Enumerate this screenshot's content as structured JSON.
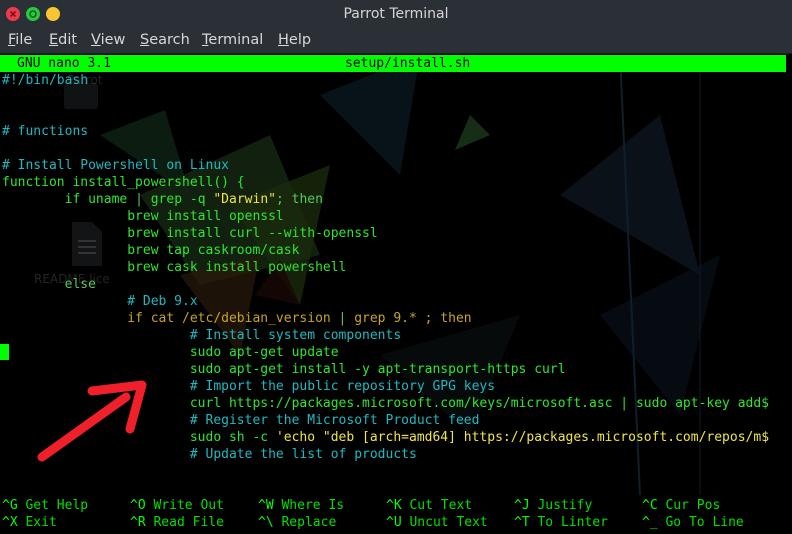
{
  "window": {
    "title": "Parrot Terminal"
  },
  "menu": [
    "File",
    "Edit",
    "View",
    "Search",
    "Terminal",
    "Help"
  ],
  "nano": {
    "version": "GNU nano 3.1",
    "filename": "setup/install.sh"
  },
  "desktop_ghost": {
    "parrot": "Parrot",
    "readme": "README.lice"
  },
  "lines": [
    [
      {
        "t": "#!/bin/bash",
        "c": "c-c"
      }
    ],
    [],
    [],
    [
      {
        "t": "# functions",
        "c": "c-c"
      }
    ],
    [],
    [
      {
        "t": "# Install Powershell on Linux",
        "c": "c-c"
      }
    ],
    [
      {
        "t": "function install_powershell() {",
        "c": "c-bg"
      }
    ],
    [
      {
        "t": "        ",
        "c": "c-g"
      },
      {
        "t": "if",
        "c": "c-bg"
      },
      {
        "t": " uname ",
        "c": "c-bg"
      },
      {
        "t": "|",
        "c": "c-k"
      },
      {
        "t": " grep -q ",
        "c": "c-bg"
      },
      {
        "t": "\"Darwin\"",
        "c": "c-y"
      },
      {
        "t": "; then",
        "c": "c-k"
      }
    ],
    [
      {
        "t": "                brew install openssl",
        "c": "c-bg"
      }
    ],
    [
      {
        "t": "                brew install curl --with-openssl",
        "c": "c-bg"
      }
    ],
    [
      {
        "t": "                brew tap caskroom/cask",
        "c": "c-bg"
      }
    ],
    [
      {
        "t": "                brew cask install powershell",
        "c": "c-bg"
      }
    ],
    [
      {
        "t": "        else",
        "c": "c-k"
      }
    ],
    [
      {
        "t": "                # Deb 9.x",
        "c": "c-c"
      }
    ],
    [
      {
        "t": "                if cat /etc/debian_version ",
        "c": "c-o"
      },
      {
        "t": "|",
        "c": "c-k"
      },
      {
        "t": " grep 9.* ; then",
        "c": "c-o"
      }
    ],
    [
      {
        "t": "                        # Install system components",
        "c": "c-c"
      }
    ],
    [
      {
        "t": "                        sudo apt-get update",
        "c": "c-bg"
      }
    ],
    [
      {
        "t": "                        sudo apt-get install -y apt-transport-https curl",
        "c": "c-bg"
      }
    ],
    [
      {
        "t": "                        # Import the public repository GPG keys",
        "c": "c-c"
      }
    ],
    [
      {
        "t": "                        curl https://packages.microsoft.com/keys/microsoft.asc | sudo apt-key add$",
        "c": "c-bg"
      }
    ],
    [
      {
        "t": "                        # Register the Microsoft Product feed",
        "c": "c-c"
      }
    ],
    [
      {
        "t": "                        sudo sh -c ",
        "c": "c-bg"
      },
      {
        "t": "'echo \"deb [arch=amd64] https://packages.microsoft.com/repos/m$",
        "c": "c-y"
      }
    ],
    [
      {
        "t": "                        # Update the list of products",
        "c": "c-c"
      }
    ]
  ],
  "shortcuts": [
    [
      {
        "key": "^G",
        "label": "Get Help"
      },
      {
        "key": "^X",
        "label": "Exit"
      }
    ],
    [
      {
        "key": "^O",
        "label": "Write Out"
      },
      {
        "key": "^R",
        "label": "Read File"
      }
    ],
    [
      {
        "key": "^W",
        "label": "Where Is"
      },
      {
        "key": "^\\",
        "label": "Replace"
      }
    ],
    [
      {
        "key": "^K",
        "label": "Cut Text"
      },
      {
        "key": "^U",
        "label": "Uncut Text"
      }
    ],
    [
      {
        "key": "^J",
        "label": "Justify"
      },
      {
        "key": "^T",
        "label": "To Linter"
      }
    ],
    [
      {
        "key": "^C",
        "label": "Cur Pos"
      },
      {
        "key": "^_",
        "label": "Go To Line"
      }
    ]
  ]
}
